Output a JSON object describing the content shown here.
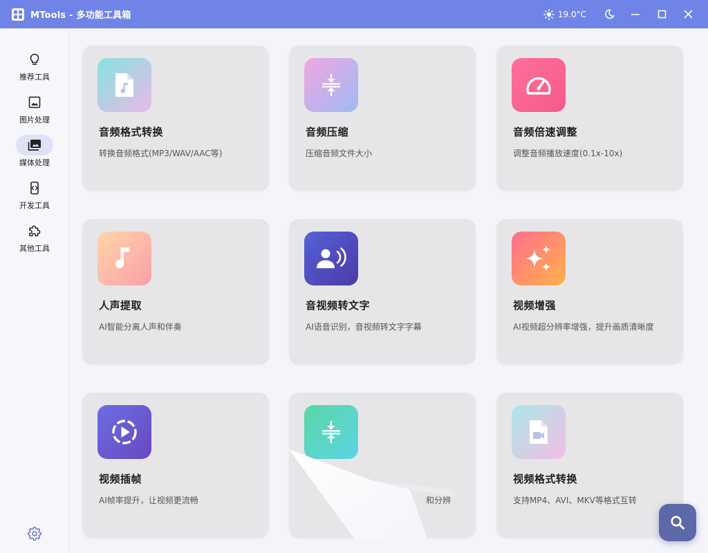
{
  "window": {
    "title": "MTools - 多功能工具箱",
    "temperature": "19.0°C"
  },
  "sidebar": {
    "items": [
      {
        "label": "推荐工具",
        "icon": "lightbulb-icon",
        "active": false
      },
      {
        "label": "图片处理",
        "icon": "image-icon",
        "active": false
      },
      {
        "label": "媒体处理",
        "icon": "photo-library-icon",
        "active": true
      },
      {
        "label": "开发工具",
        "icon": "code-brackets-icon",
        "active": false
      },
      {
        "label": "其他工具",
        "icon": "puzzle-icon",
        "active": false
      }
    ],
    "settings_icon": "gear-icon"
  },
  "tools": [
    {
      "title": "音频格式转换",
      "desc": "转换音频格式(MP3/WAV/AAC等)",
      "icon": "audio-file-icon"
    },
    {
      "title": "音频压缩",
      "desc": "压缩音频文件大小",
      "icon": "compress-icon"
    },
    {
      "title": "音频倍速调整",
      "desc": "调整音频播放速度(0.1x-10x)",
      "icon": "speedometer-icon"
    },
    {
      "title": "人声提取",
      "desc": "AI智能分离人声和伴奏",
      "icon": "music-note-icon"
    },
    {
      "title": "音视频转文字",
      "desc": "AI语音识别，音视频转文字字幕",
      "icon": "voice-recognition-icon"
    },
    {
      "title": "视频增强",
      "desc": "AI视频超分辨率增强，提升画质清晰度",
      "icon": "sparkle-icon"
    },
    {
      "title": "视频插帧",
      "desc": "AI帧率提升，让视频更流畅",
      "icon": "play-circle-icon"
    },
    {
      "title": "",
      "desc": "和分辨",
      "icon": "compress-icon"
    },
    {
      "title": "视频格式转换",
      "desc": "支持MP4、AVI、MKV等格式互转",
      "icon": "video-file-icon"
    }
  ],
  "fab": {
    "icon": "search-icon"
  }
}
